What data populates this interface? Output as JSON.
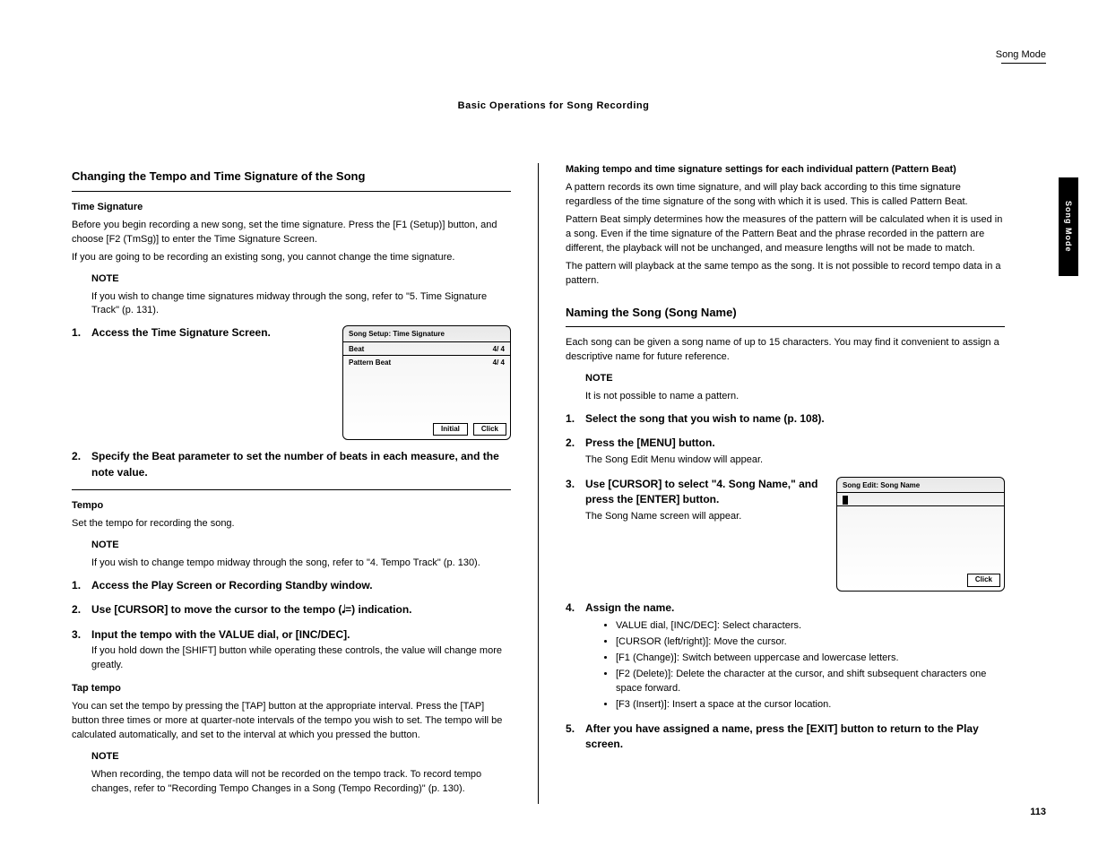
{
  "header": {
    "breadcrumb": "Song Mode",
    "section": "Basic Operations for Song Recording"
  },
  "sideTab": "Song Mode",
  "leftCol": {
    "h2": "Changing the Tempo and Time Signature of the Song",
    "timeSig": {
      "title": "Time Signature",
      "paras": [
        "Before you begin recording a new song, set the time signature. Press the [F1 (Setup)] button, and choose [F2 (TmSg)] to enter the Time Signature Screen.",
        "If you are going to be recording an existing song, you cannot change the time signature."
      ],
      "note": "If you wish to change time signatures midway through the song, refer to \"5. Time Signature Track\" (p. 131).",
      "steps": [
        {
          "text": "Access the Time Signature Screen.",
          "lcd": {
            "title": "Song Setup: Time Signature",
            "line1": {
              "l": "Beat",
              "r": "4/ 4"
            },
            "line2": {
              "l": "Pattern Beat",
              "r": "4/ 4"
            },
            "btns": [
              "Initial",
              "Click"
            ]
          }
        },
        {
          "text": "Specify the Beat parameter to set the number of beats in each measure, and the note value."
        }
      ]
    },
    "tempo": {
      "title": "Tempo",
      "para": "Set the tempo for recording the song.",
      "note": "If you wish to change tempo midway through the song, refer to \"4. Tempo Track\" (p. 130).",
      "steps": [
        {
          "text": "Access the Play Screen or Recording Standby window."
        },
        {
          "text": "Use [CURSOR] to move the cursor to the tempo (𝅘𝅥=) indication."
        },
        {
          "text": "Input the tempo with the VALUE dial, or [INC/DEC].",
          "sub": "If you hold down the [SHIFT] button while operating these controls, the value will change more greatly."
        }
      ],
      "tapTitle": "Tap tempo",
      "tapPara": "You can set the tempo by pressing the [TAP] button at the appropriate interval. Press the [TAP] button three times or more at quarter-note intervals of the tempo you wish to set. The tempo will be calculated automatically, and set to the interval at which you pressed the button.",
      "tapNote": "When recording, the tempo data will not be recorded on the tempo track. To record tempo changes, refer to \"Recording Tempo Changes in a Song (Tempo Recording)\" (p. 130)."
    }
  },
  "rightCol": {
    "intro": {
      "h2": "",
      "title": "Making tempo and time signature settings for each individual pattern (Pattern Beat)",
      "para1": "A pattern records its own time signature, and will play back according to this time signature regardless of the time signature of the song with which it is used. This is called Pattern Beat.",
      "para2": "Pattern Beat simply determines how the measures of the pattern will be calculated when it is used in a song. Even if the time signature of the Pattern Beat and the phrase recorded in the pattern are different, the playback will not be unchanged, and measure lengths will not be made to match.",
      "para3": "The pattern will playback at the same tempo as the song. It is not possible to record tempo data in a pattern."
    },
    "naming": {
      "h2": "Naming the Song (Song Name)",
      "para": "Each song can be given a song name of up to 15 characters. You may find it convenient to assign a descriptive name for future reference.",
      "note": "It is not possible to name a pattern.",
      "steps": [
        {
          "text": "Select the song that you wish to name (p. 108)."
        },
        {
          "text": "Press the [MENU] button.",
          "sub": "The Song Edit Menu window will appear."
        },
        {
          "text": "Use [CURSOR] to select \"4. Song Name,\" and press the [ENTER] button.",
          "sub": "The Song Name screen will appear.",
          "lcd": {
            "title": "Song Edit: Song Name",
            "nameRow": true,
            "btns": [
              "Click"
            ]
          }
        },
        {
          "text": "Assign the name.",
          "bullets": [
            "VALUE dial, [INC/DEC]: Select characters.",
            "[CURSOR (left/right)]: Move the cursor.",
            "[F1 (Change)]: Switch between uppercase and lowercase letters.",
            "[F2 (Delete)]: Delete the character at the cursor, and shift subsequent characters one space forward.",
            "[F3 (Insert)]: Insert a space at the cursor location."
          ]
        },
        {
          "text": "After you have assigned a name, press the [EXIT] button to return to the Play screen."
        }
      ]
    }
  },
  "footer": {
    "page": "113"
  },
  "labels": {
    "note": "NOTE"
  }
}
